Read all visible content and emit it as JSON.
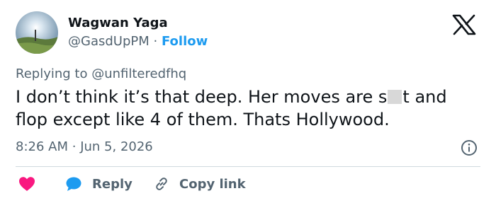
{
  "author": {
    "display_name": "Wagwan Yaga",
    "handle": "@GasdUpPM",
    "separator": "·",
    "follow_label": "Follow",
    "avatar_icon": "landscape-avatar-icon"
  },
  "platform_icon": "x-logo-icon",
  "reply_context": {
    "prefix": "Replying to",
    "mention": "@unfilteredfhq"
  },
  "tweet": {
    "text_before_censor": "I don’t think it’s that deep. Her moves are s",
    "text_after_censor": "t and flop except like 4 of them. Thats Hollywood."
  },
  "meta": {
    "time": "8:26 AM",
    "separator": "·",
    "date": "Jun 5, 2026"
  },
  "actions": {
    "like_icon": "heart-icon",
    "reply_label": "Reply",
    "copy_label": "Copy link"
  },
  "colors": {
    "accent": "#1d9bf0",
    "like": "#f91880",
    "text": "#0f1419",
    "muted": "#536471",
    "divider": "#cfd9de"
  }
}
